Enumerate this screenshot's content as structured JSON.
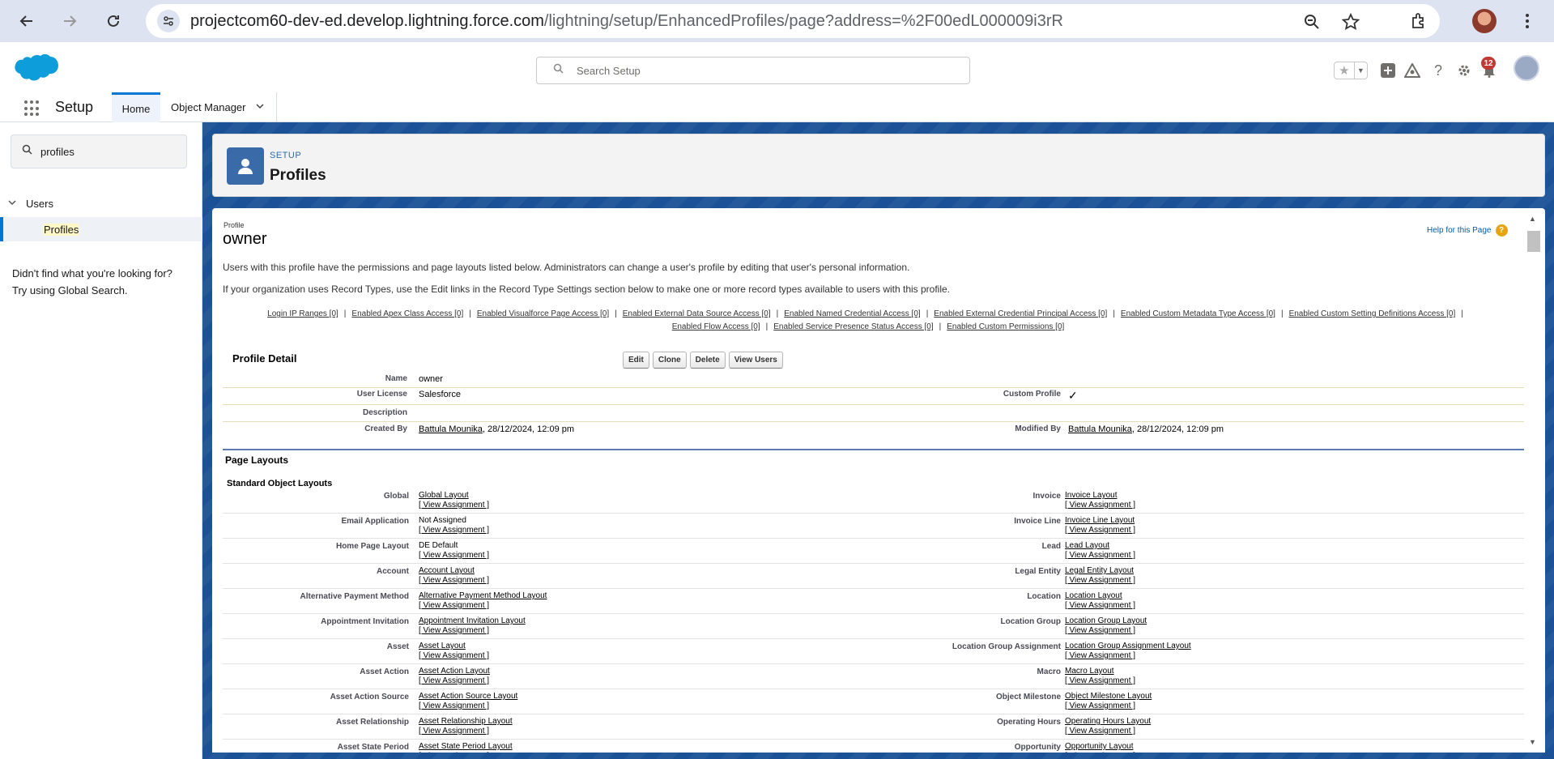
{
  "browser": {
    "url_host": "projectcom60-dev-ed.develop.lightning.force.com",
    "url_path": "/lightning/setup/EnhancedProfiles/page?address=%2F00edL000009i3rR"
  },
  "header": {
    "search_placeholder": "Search Setup",
    "notification_count": "12"
  },
  "appnav": {
    "app_name": "Setup",
    "tabs": [
      "Home",
      "Object Manager"
    ]
  },
  "sidebar": {
    "quickfind_value": "profiles",
    "tree_users": "Users",
    "tree_profiles": "Profiles",
    "not_found_line1": "Didn't find what you're looking for?",
    "not_found_line2": "Try using Global Search."
  },
  "page_header": {
    "eyebrow": "SETUP",
    "title": "Profiles"
  },
  "profile": {
    "label": "Profile",
    "name": "owner",
    "help_link": "Help for this Page",
    "info1": "Users with this profile have the permissions and page layouts listed below. Administrators can change a user's profile by editing that user's personal information.",
    "info2": "If your organization uses Record Types, use the Edit links in the Record Type Settings section below to make one or more record types available to users with this profile.",
    "links_row1": [
      "Login IP Ranges [0]",
      "Enabled Apex Class Access [0]",
      "Enabled Visualforce Page Access [0]",
      "Enabled External Data Source Access [0]",
      "Enabled Named Credential Access [0]",
      "Enabled External Credential Principal Access [0]",
      "Enabled Custom Metadata Type Access [0]",
      "Enabled Custom Setting Definitions Access [0]"
    ],
    "links_row2": [
      "Enabled Flow Access [0]",
      "Enabled Service Presence Status Access [0]",
      "Enabled Custom Permissions [0]"
    ],
    "sep": "|"
  },
  "detail": {
    "title": "Profile Detail",
    "buttons": [
      "Edit",
      "Clone",
      "Delete",
      "View Users"
    ],
    "name_label": "Name",
    "name_value": "owner",
    "license_label": "User License",
    "license_value": "Salesforce",
    "custom_label": "Custom Profile",
    "custom_value": "✓",
    "description_label": "Description",
    "created_label": "Created By",
    "created_user": "Battula Mounika",
    "created_date": ", 28/12/2024, 12:09 pm",
    "modified_label": "Modified By",
    "modified_user": "Battula Mounika",
    "modified_date": ", 28/12/2024, 12:09 pm"
  },
  "layouts": {
    "section_title": "Page Layouts",
    "subsection_title": "Standard Object Layouts",
    "view_assignment": "[ View Assignment ]",
    "rows": [
      {
        "left_label": "Global",
        "left_value": "Global Layout",
        "left_link": true,
        "right_label": "Invoice",
        "right_value": "Invoice Layout"
      },
      {
        "left_label": "Email Application",
        "left_value": "Not Assigned",
        "left_link": false,
        "right_label": "Invoice Line",
        "right_value": "Invoice Line Layout"
      },
      {
        "left_label": "Home Page Layout",
        "left_value": "DE Default",
        "left_link": false,
        "right_label": "Lead",
        "right_value": "Lead Layout"
      },
      {
        "left_label": "Account",
        "left_value": "Account Layout",
        "left_link": true,
        "right_label": "Legal Entity",
        "right_value": "Legal Entity Layout"
      },
      {
        "left_label": "Alternative Payment Method",
        "left_value": "Alternative Payment Method Layout",
        "left_link": true,
        "right_label": "Location",
        "right_value": "Location Layout"
      },
      {
        "left_label": "Appointment Invitation",
        "left_value": "Appointment Invitation Layout",
        "left_link": true,
        "right_label": "Location Group",
        "right_value": "Location Group Layout"
      },
      {
        "left_label": "Asset",
        "left_value": "Asset Layout",
        "left_link": true,
        "right_label": "Location Group Assignment",
        "right_value": "Location Group Assignment Layout"
      },
      {
        "left_label": "Asset Action",
        "left_value": "Asset Action Layout",
        "left_link": true,
        "right_label": "Macro",
        "right_value": "Macro Layout"
      },
      {
        "left_label": "Asset Action Source",
        "left_value": "Asset Action Source Layout",
        "left_link": true,
        "right_label": "Object Milestone",
        "right_value": "Object Milestone Layout"
      },
      {
        "left_label": "Asset Relationship",
        "left_value": "Asset Relationship Layout",
        "left_link": true,
        "right_label": "Operating Hours",
        "right_value": "Operating Hours Layout"
      },
      {
        "left_label": "Asset State Period",
        "left_value": "Asset State Period Layout",
        "left_link": true,
        "right_label": "Opportunity",
        "right_value": "Opportunity Layout"
      }
    ]
  }
}
